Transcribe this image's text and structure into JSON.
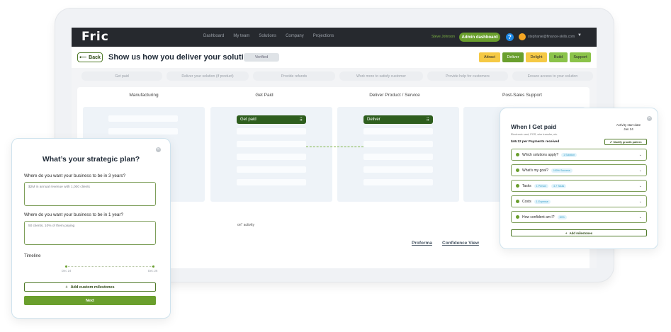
{
  "app": {
    "logo": "Fric",
    "nav": [
      "Dashboard",
      "My team",
      "Solutions",
      "Company",
      "Projections"
    ],
    "user_name": "Steve Johnson",
    "admin_label": "Admin dashboard",
    "help_glyph": "?",
    "email": "stephanie@finance-skills.com"
  },
  "header": {
    "back_label": "Back",
    "title": "Show us how you deliver your solution",
    "verified_label": "Verified",
    "stages": [
      {
        "label": "Attract",
        "color": "#f5c945"
      },
      {
        "label": "Deliver",
        "color": "#6a9f2d"
      },
      {
        "label": "Delight",
        "color": "#f5c945"
      },
      {
        "label": "Build",
        "color": "#8bc34a"
      },
      {
        "label": "Support",
        "color": "#8bc34a"
      }
    ]
  },
  "subtabs": [
    "Get paid",
    "Deliver your solution (if product)",
    "Provide refunds",
    "Work more to satisfy customer",
    "Provide help for customers",
    "Ensure access to your solution"
  ],
  "board": {
    "columns": [
      "Manufacturing",
      "Get Paid",
      "Deliver Product / Service",
      "Post-Sales Support"
    ],
    "nodes": {
      "get_paid": "Get paid",
      "deliver": "Deliver"
    },
    "activity": "on\" activity",
    "links": {
      "proforma": "Proforma",
      "confidence": "Confidence View"
    }
  },
  "strategic_modal": {
    "title": "What’s your strategic plan?",
    "q1": "Where do you want your business to be in 3 years?",
    "q1_value": "$2M in annual revenue with 1,000 clients",
    "q2": "Where do you want your business to be in 1 year?",
    "q2_value": "50 clients, 10% of them paying",
    "timeline_label": "Timeline",
    "date_start": "Dec 24",
    "date_end": "Dec 26",
    "add_milestones": "Add custom milestones",
    "next": "Next"
  },
  "paid_modal": {
    "title": "When I Get paid",
    "subtitle": "Electronic card, POS, wire transfer, etc.",
    "start_label": "Activity start date",
    "start_value": "Jan 24",
    "payments": "$46.12 per Payments received",
    "modify": "Modify growth pattern",
    "rows": [
      {
        "label": "Which solutions apply?",
        "chips": [
          "1 Solution"
        ]
      },
      {
        "label": "What's my goal?",
        "chips": [
          "100% Success"
        ]
      },
      {
        "label": "Tasks",
        "chips": [
          "1 Person",
          "4.7 Tasks"
        ]
      },
      {
        "label": "Costs",
        "chips": [
          "1 Expense"
        ]
      },
      {
        "label": "How confident am I?",
        "chips": [
          "50%"
        ]
      }
    ],
    "add_milestones": "Add milestones"
  }
}
